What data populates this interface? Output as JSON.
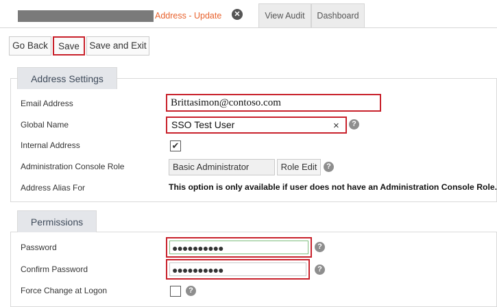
{
  "tabs": {
    "active_label": "Address - Update",
    "close_symbol": "✕",
    "view_audit": "View Audit",
    "dashboard": "Dashboard"
  },
  "toolbar": {
    "go_back": "Go Back",
    "save": "Save",
    "save_and_exit": "Save and Exit"
  },
  "address_settings": {
    "title": "Address Settings",
    "email_label": "Email Address",
    "email_value": "Brittasimon@contoso.com",
    "global_name_label": "Global Name",
    "global_name_value": "SSO Test User",
    "clear_symbol": "×",
    "internal_address_label": "Internal Address",
    "internal_address_checked": true,
    "admin_role_label": "Administration Console Role",
    "admin_role_value": "Basic Administrator",
    "role_edit_button": "Role Edit",
    "alias_label": "Address Alias For",
    "alias_note": "This option is only available if user does not have an Administration Console Role."
  },
  "permissions": {
    "title": "Permissions",
    "password_label": "Password",
    "password_value": "●●●●●●●●●●",
    "confirm_password_label": "Confirm Password",
    "confirm_password_value": "●●●●●●●●●●",
    "force_change_label": "Force Change at Logon",
    "force_change_checked": false
  },
  "help_symbol": "?",
  "colors": {
    "highlight": "#c8202a",
    "active_tab_text": "#e8612c"
  }
}
